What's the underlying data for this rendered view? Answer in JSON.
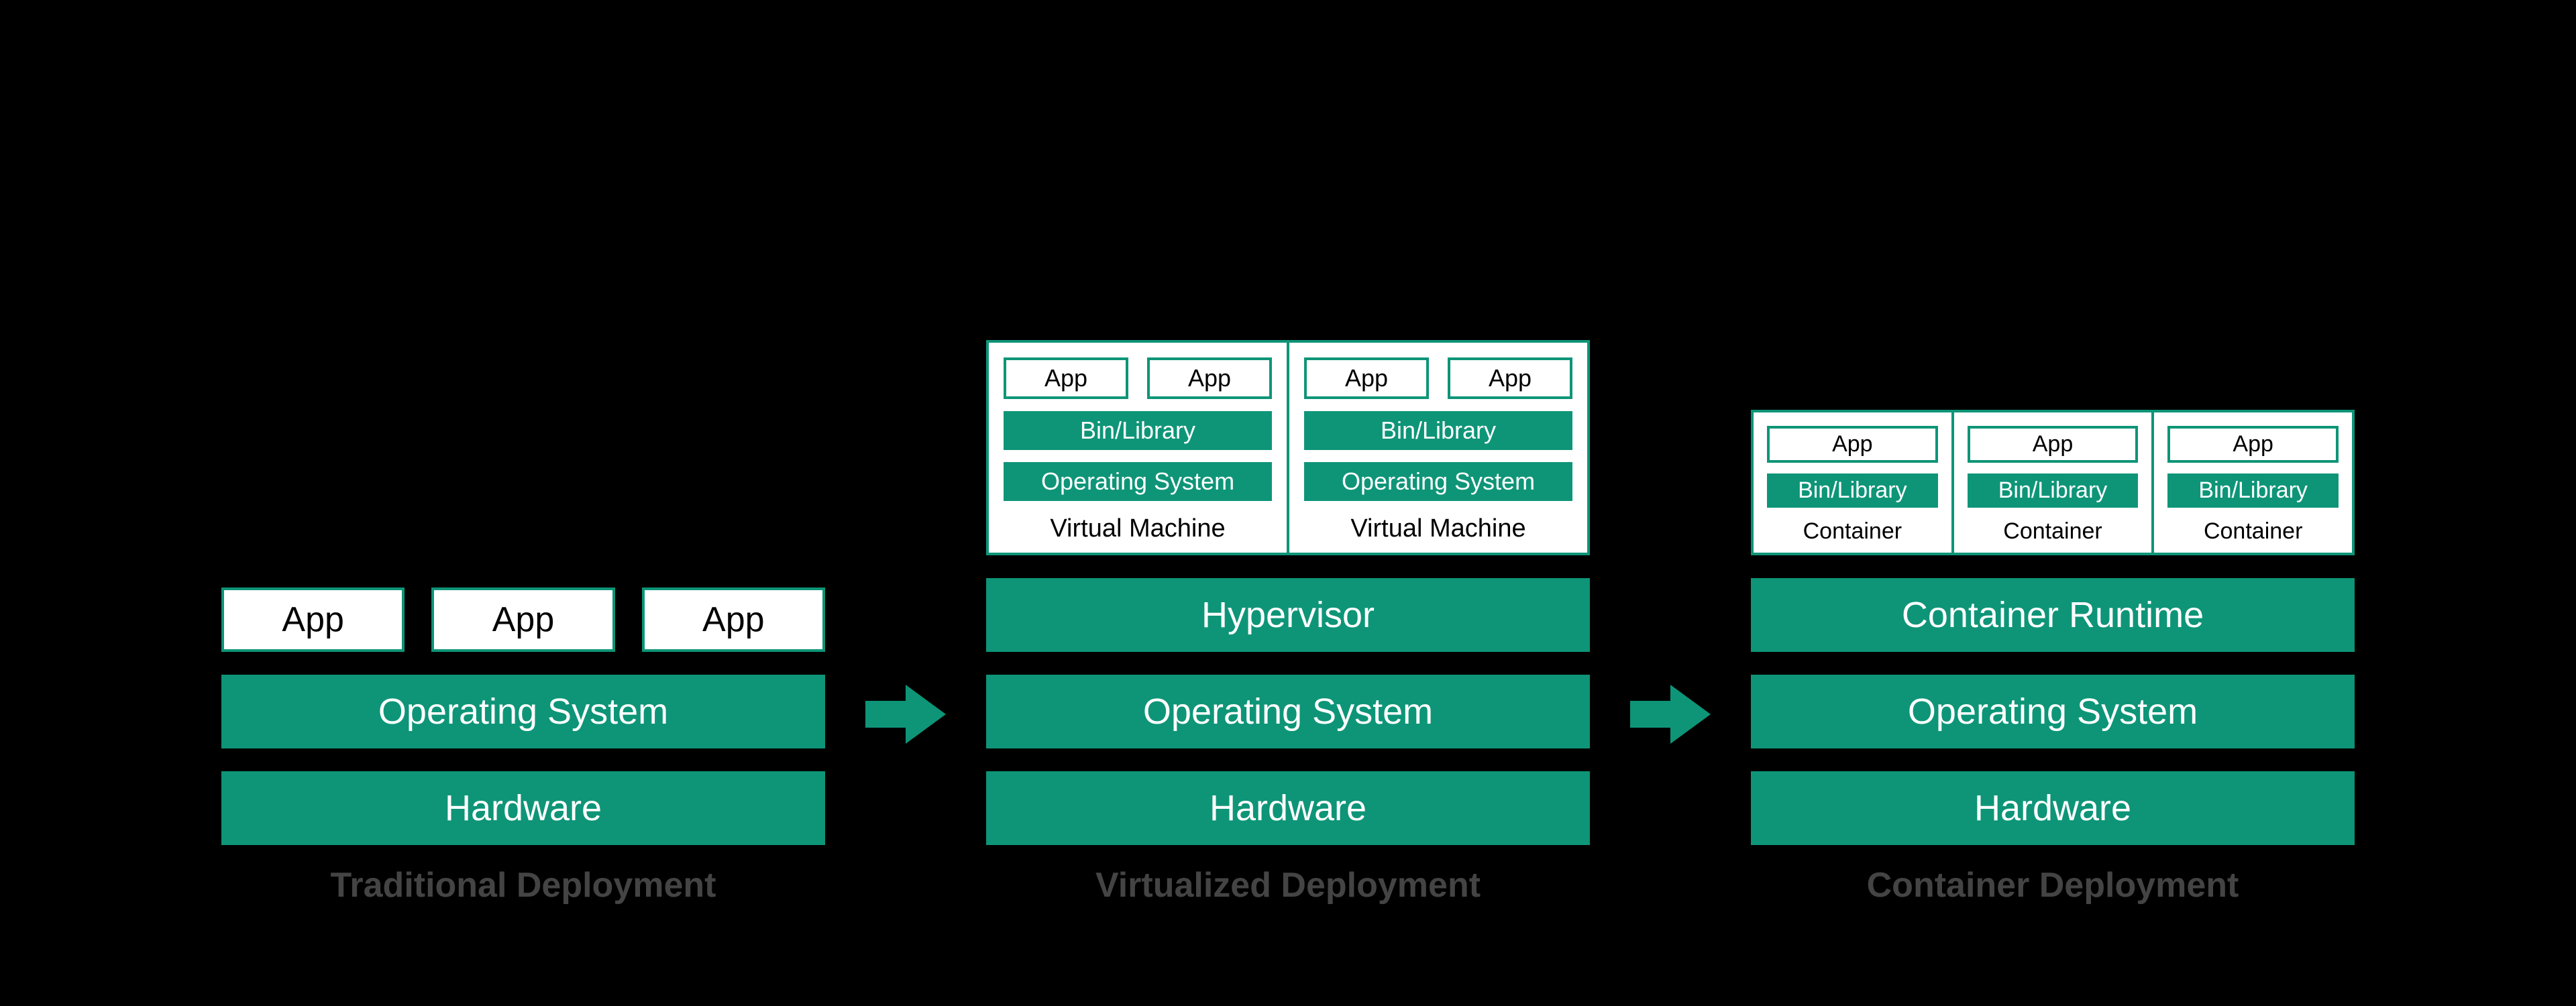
{
  "colors": {
    "accent": "#0e9578",
    "bg": "#000000",
    "panel": "#ffffff",
    "caption": "#444444"
  },
  "labels": {
    "app": "App",
    "binlib": "Bin/Library",
    "os": "Operating System",
    "hw": "Hardware",
    "vm": "Virtual Machine",
    "hypervisor": "Hypervisor",
    "container": "Container",
    "container_runtime": "Container Runtime"
  },
  "columns": {
    "traditional": {
      "caption": "Traditional Deployment",
      "apps": [
        "App",
        "App",
        "App"
      ],
      "layers": [
        "Operating System",
        "Hardware"
      ]
    },
    "virtualized": {
      "caption": "Virtualized Deployment",
      "vms": [
        {
          "apps": [
            "App",
            "App"
          ],
          "binlib": "Bin/Library",
          "os": "Operating System",
          "label": "Virtual Machine"
        },
        {
          "apps": [
            "App",
            "App"
          ],
          "binlib": "Bin/Library",
          "os": "Operating System",
          "label": "Virtual Machine"
        }
      ],
      "layers": [
        "Hypervisor",
        "Operating System",
        "Hardware"
      ]
    },
    "container": {
      "caption": "Container Deployment",
      "containers": [
        {
          "app": "App",
          "binlib": "Bin/Library",
          "label": "Container"
        },
        {
          "app": "App",
          "binlib": "Bin/Library",
          "label": "Container"
        },
        {
          "app": "App",
          "binlib": "Bin/Library",
          "label": "Container"
        }
      ],
      "layers": [
        "Container Runtime",
        "Operating System",
        "Hardware"
      ]
    }
  }
}
